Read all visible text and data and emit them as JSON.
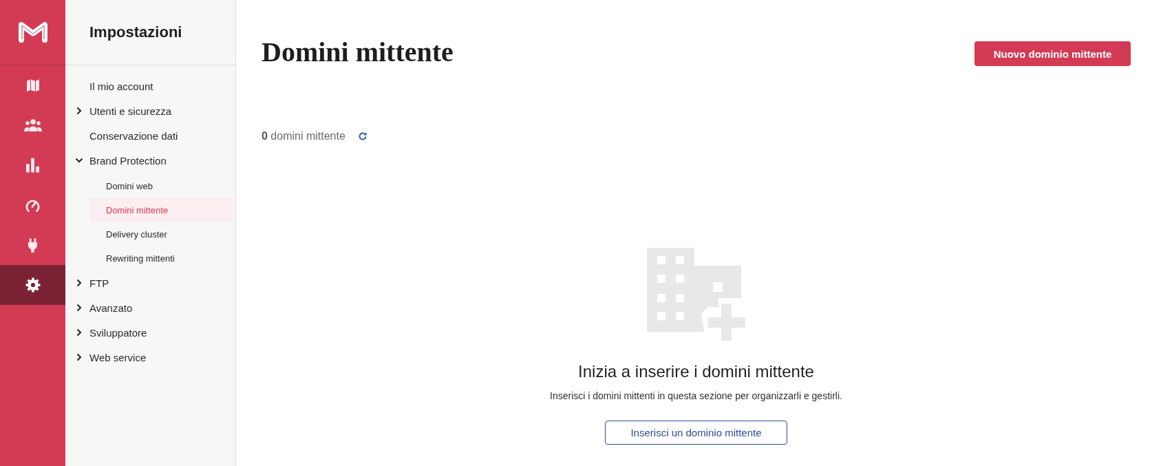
{
  "rail": {
    "items": [
      {
        "kind": "map",
        "selected": false
      },
      {
        "kind": "users",
        "selected": false
      },
      {
        "kind": "chart",
        "selected": false
      },
      {
        "kind": "gauge",
        "selected": false
      },
      {
        "kind": "plug",
        "selected": false
      },
      {
        "kind": "gear",
        "selected": true
      }
    ]
  },
  "sidebar": {
    "title": "Impostazioni",
    "items": [
      {
        "kind": "link",
        "label": "Il mio account",
        "selected": false
      },
      {
        "kind": "group",
        "label": "Utenti e sicurezza",
        "expanded": false
      },
      {
        "kind": "link",
        "label": "Conservazione dati",
        "selected": false
      },
      {
        "kind": "group",
        "label": "Brand Protection",
        "expanded": true,
        "children": [
          {
            "label": "Domini web",
            "selected": false
          },
          {
            "label": "Domini mittente",
            "selected": true
          },
          {
            "label": "Delivery cluster",
            "selected": false
          },
          {
            "label": "Rewriting mittenti",
            "selected": false
          }
        ]
      },
      {
        "kind": "group",
        "label": "FTP",
        "expanded": false
      },
      {
        "kind": "group",
        "label": "Avanzato",
        "expanded": false
      },
      {
        "kind": "group",
        "label": "Sviluppatore",
        "expanded": false
      },
      {
        "kind": "group",
        "label": "Web service",
        "expanded": false
      }
    ]
  },
  "page": {
    "title": "Domini mittente",
    "primary_button": "Nuovo dominio mittente",
    "count": "**0** domini mittente",
    "empty_state": {
      "heading": "Inizia a inserire i domini mittente",
      "text": "Inserisci i domini mittenti in questa sezione per organizzarli e gestirli.",
      "button": "Inserisci un dominio mittente"
    }
  }
}
